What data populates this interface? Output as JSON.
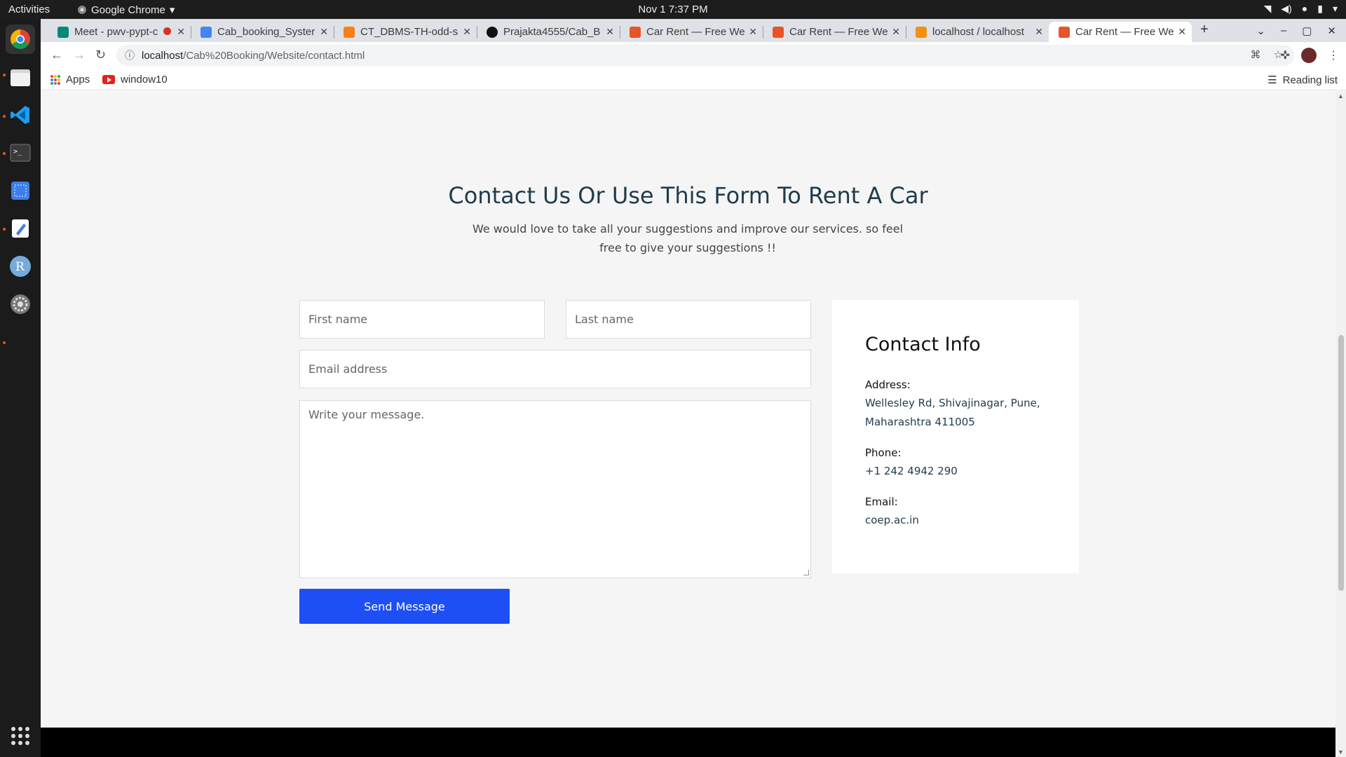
{
  "topbar": {
    "activities": "Activities",
    "app_name": "Google Chrome",
    "clock": "Nov 1  7:37 PM"
  },
  "tabs": [
    {
      "title": "Meet - pwv-pypt-c",
      "icon": "google-meet-icon",
      "color": "#00897b"
    },
    {
      "title": "Cab_booking_Syster",
      "icon": "google-docs-icon",
      "color": "#4285f4"
    },
    {
      "title": "CT_DBMS-TH-odd-se",
      "icon": "moodle-icon",
      "color": "#f98012"
    },
    {
      "title": "Prajakta4555/Cab_B",
      "icon": "github-icon",
      "color": "#000000"
    },
    {
      "title": "Car Rent — Free Web",
      "icon": "colorlib-icon",
      "color": "#e8542a"
    },
    {
      "title": "Car Rent — Free Web",
      "icon": "colorlib-icon",
      "color": "#e8542a"
    },
    {
      "title": "localhost / localhost",
      "icon": "phpmyadmin-icon",
      "color": "#f29111"
    },
    {
      "title": "Car Rent — Free Web",
      "icon": "colorlib-icon",
      "color": "#e8542a"
    }
  ],
  "url": {
    "host": "localhost",
    "path": "/Cab%20Booking/Website/contact.html"
  },
  "bookmarks": {
    "apps": "Apps",
    "window10": "window10",
    "reading_list": "Reading list"
  },
  "page": {
    "title": "Contact Us Or Use This Form To Rent A Car",
    "subtitle": "We would love to take all your suggestions and improve our services. so feel free to give your suggestions !!",
    "form": {
      "first_name_placeholder": "First name",
      "last_name_placeholder": "Last name",
      "email_placeholder": "Email address",
      "message_placeholder": "Write your message.",
      "send_label": "Send Message"
    },
    "contact_info": {
      "heading": "Contact Info",
      "address_label": "Address:",
      "address_value": "Wellesley Rd, Shivajinagar, Pune, Maharashtra 411005",
      "phone_label": "Phone:",
      "phone_value": "+1 242 4942 290",
      "email_label": "Email:",
      "email_value": "coep.ac.in"
    }
  },
  "colors": {
    "accent": "#1d4ff5",
    "heading": "#1f3b4d"
  }
}
